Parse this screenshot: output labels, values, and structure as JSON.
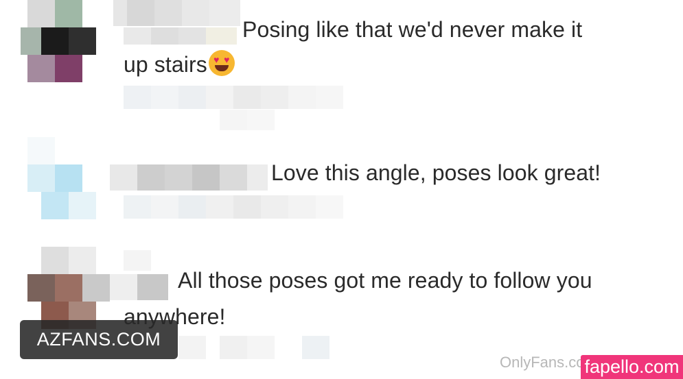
{
  "comments": [
    {
      "text_line1": "Posing like that we'd never make it",
      "text_line2": "up stairs",
      "emoji": "heart-eyes-emoji"
    },
    {
      "text_line1": "Love this angle, poses look great!"
    },
    {
      "text_line1": "All those poses got me ready to follow you",
      "text_line2": "anywhere!"
    }
  ],
  "watermarks": {
    "azfans": "AZFANS.COM",
    "onlyfans": "OnlyFans.co",
    "fapello": "fapello.com"
  },
  "colors": {
    "fapello_badge": "#f0357a",
    "azfans_badge": "#282828",
    "text": "#2a2a2a"
  }
}
